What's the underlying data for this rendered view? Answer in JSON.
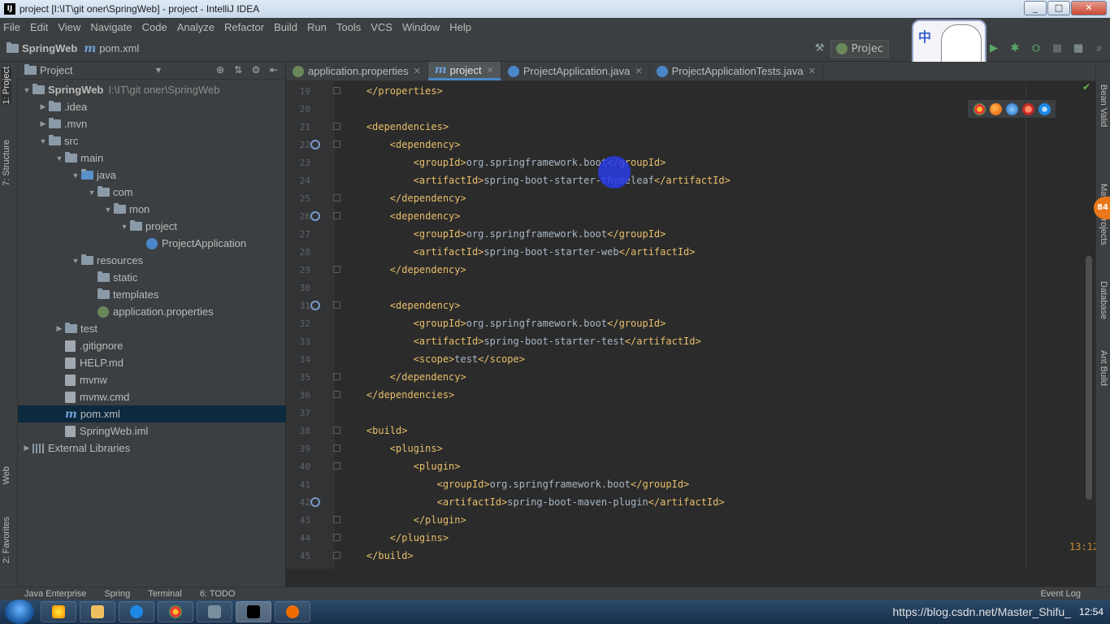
{
  "window": {
    "title": "project [I:\\IT\\git oner\\SpringWeb] - project - IntelliJ IDEA",
    "app_icon": "IJ"
  },
  "menu": [
    "File",
    "Edit",
    "View",
    "Navigate",
    "Code",
    "Analyze",
    "Refactor",
    "Build",
    "Run",
    "Tools",
    "VCS",
    "Window",
    "Help"
  ],
  "breadcrumb": {
    "project": "SpringWeb",
    "file": "pom.xml"
  },
  "toolbar": {
    "run_config": "Projec",
    "mascot_text": "中"
  },
  "project_panel": {
    "title": "Project",
    "tree": [
      {
        "label": "SpringWeb",
        "path": "I:\\IT\\git oner\\SpringWeb",
        "indent": 0,
        "arrow": "open",
        "icon": "folder"
      },
      {
        "label": ".idea",
        "indent": 1,
        "arrow": "closed",
        "icon": "folder"
      },
      {
        "label": ".mvn",
        "indent": 1,
        "arrow": "closed",
        "icon": "folder"
      },
      {
        "label": "src",
        "indent": 1,
        "arrow": "open",
        "icon": "folder"
      },
      {
        "label": "main",
        "indent": 2,
        "arrow": "open",
        "icon": "folder"
      },
      {
        "label": "java",
        "indent": 3,
        "arrow": "open",
        "icon": "folder-blue"
      },
      {
        "label": "com",
        "indent": 4,
        "arrow": "open",
        "icon": "folder"
      },
      {
        "label": "mon",
        "indent": 5,
        "arrow": "open",
        "icon": "folder"
      },
      {
        "label": "project",
        "indent": 6,
        "arrow": "open",
        "icon": "folder"
      },
      {
        "label": "ProjectApplication",
        "indent": 7,
        "arrow": "none",
        "icon": "class"
      },
      {
        "label": "resources",
        "indent": 3,
        "arrow": "open",
        "icon": "folder"
      },
      {
        "label": "static",
        "indent": 4,
        "arrow": "none",
        "icon": "folder"
      },
      {
        "label": "templates",
        "indent": 4,
        "arrow": "none",
        "icon": "folder"
      },
      {
        "label": "application.properties",
        "indent": 4,
        "arrow": "none",
        "icon": "leaf"
      },
      {
        "label": "test",
        "indent": 2,
        "arrow": "closed",
        "icon": "folder"
      },
      {
        "label": ".gitignore",
        "indent": 2,
        "arrow": "none",
        "icon": "file"
      },
      {
        "label": "HELP.md",
        "indent": 2,
        "arrow": "none",
        "icon": "file"
      },
      {
        "label": "mvnw",
        "indent": 2,
        "arrow": "none",
        "icon": "file"
      },
      {
        "label": "mvnw.cmd",
        "indent": 2,
        "arrow": "none",
        "icon": "file"
      },
      {
        "label": "pom.xml",
        "indent": 2,
        "arrow": "none",
        "icon": "maven",
        "selected": true
      },
      {
        "label": "SpringWeb.iml",
        "indent": 2,
        "arrow": "none",
        "icon": "file"
      },
      {
        "label": "External Libraries",
        "indent": 0,
        "arrow": "closed",
        "icon": "lib"
      }
    ]
  },
  "editor_tabs": [
    {
      "label": "application.properties",
      "icon": "leaf",
      "active": false
    },
    {
      "label": "project",
      "icon": "maven",
      "active": true
    },
    {
      "label": "ProjectApplication.java",
      "icon": "class",
      "active": false
    },
    {
      "label": "ProjectApplicationTests.java",
      "icon": "class",
      "active": false
    }
  ],
  "code_lines": [
    {
      "n": "19",
      "code": "    </properties>"
    },
    {
      "n": "20",
      "code": ""
    },
    {
      "n": "21",
      "code": "    <dependencies>"
    },
    {
      "n": "22",
      "code": "        <dependency>"
    },
    {
      "n": "23",
      "code": "            <groupId>org.springframework.boot</groupId>"
    },
    {
      "n": "24",
      "code": "            <artifactId>spring-boot-starter-thymeleaf</artifactId>"
    },
    {
      "n": "25",
      "code": "        </dependency>"
    },
    {
      "n": "26",
      "code": "        <dependency>"
    },
    {
      "n": "27",
      "code": "            <groupId>org.springframework.boot</groupId>"
    },
    {
      "n": "28",
      "code": "            <artifactId>spring-boot-starter-web</artifactId>"
    },
    {
      "n": "29",
      "code": "        </dependency>"
    },
    {
      "n": "30",
      "code": ""
    },
    {
      "n": "31",
      "code": "        <dependency>"
    },
    {
      "n": "32",
      "code": "            <groupId>org.springframework.boot</groupId>"
    },
    {
      "n": "33",
      "code": "            <artifactId>spring-boot-starter-test</artifactId>"
    },
    {
      "n": "34",
      "code": "            <scope>test</scope>"
    },
    {
      "n": "35",
      "code": "        </dependency>"
    },
    {
      "n": "36",
      "code": "    </dependencies>"
    },
    {
      "n": "37",
      "code": ""
    },
    {
      "n": "38",
      "code": "    <build>"
    },
    {
      "n": "39",
      "code": "        <plugins>"
    },
    {
      "n": "40",
      "code": "            <plugin>"
    },
    {
      "n": "41",
      "code": "                <groupId>org.springframework.boot</groupId>"
    },
    {
      "n": "42",
      "code": "                <artifactId>spring-boot-maven-plugin</artifactId>"
    },
    {
      "n": "43",
      "code": "            </plugin>"
    },
    {
      "n": "44",
      "code": "        </plugins>"
    },
    {
      "n": "45",
      "code": "    </build>"
    }
  ],
  "gutter_markers": [
    "22",
    "26",
    "31",
    "42"
  ],
  "cursor_position": "13:12",
  "left_tabs": {
    "project": "1: Project",
    "structure": "7: Structure",
    "web": "Web",
    "favorites": "2: Favorites"
  },
  "right_tabs": {
    "bean": "Bean Valid",
    "maven": "Maven Projects",
    "database": "Database",
    "ant": "Ant Build"
  },
  "notification_badge": "84",
  "bottom_tools": [
    "Java Enterprise",
    "Spring",
    "Terminal",
    "6: TODO"
  ],
  "event_log": "Event Log",
  "taskbar": {
    "watermark": "https://blog.csdn.net/Master_Shifu_",
    "clock": "12:54"
  },
  "colors": {
    "editor_bg": "#2b2b2b",
    "panel_bg": "#3c3f41",
    "xml_tag": "#e8bf6a",
    "text": "#a9b7c6",
    "selection": "#0d293e",
    "active_tab_border": "#4a88c7"
  }
}
